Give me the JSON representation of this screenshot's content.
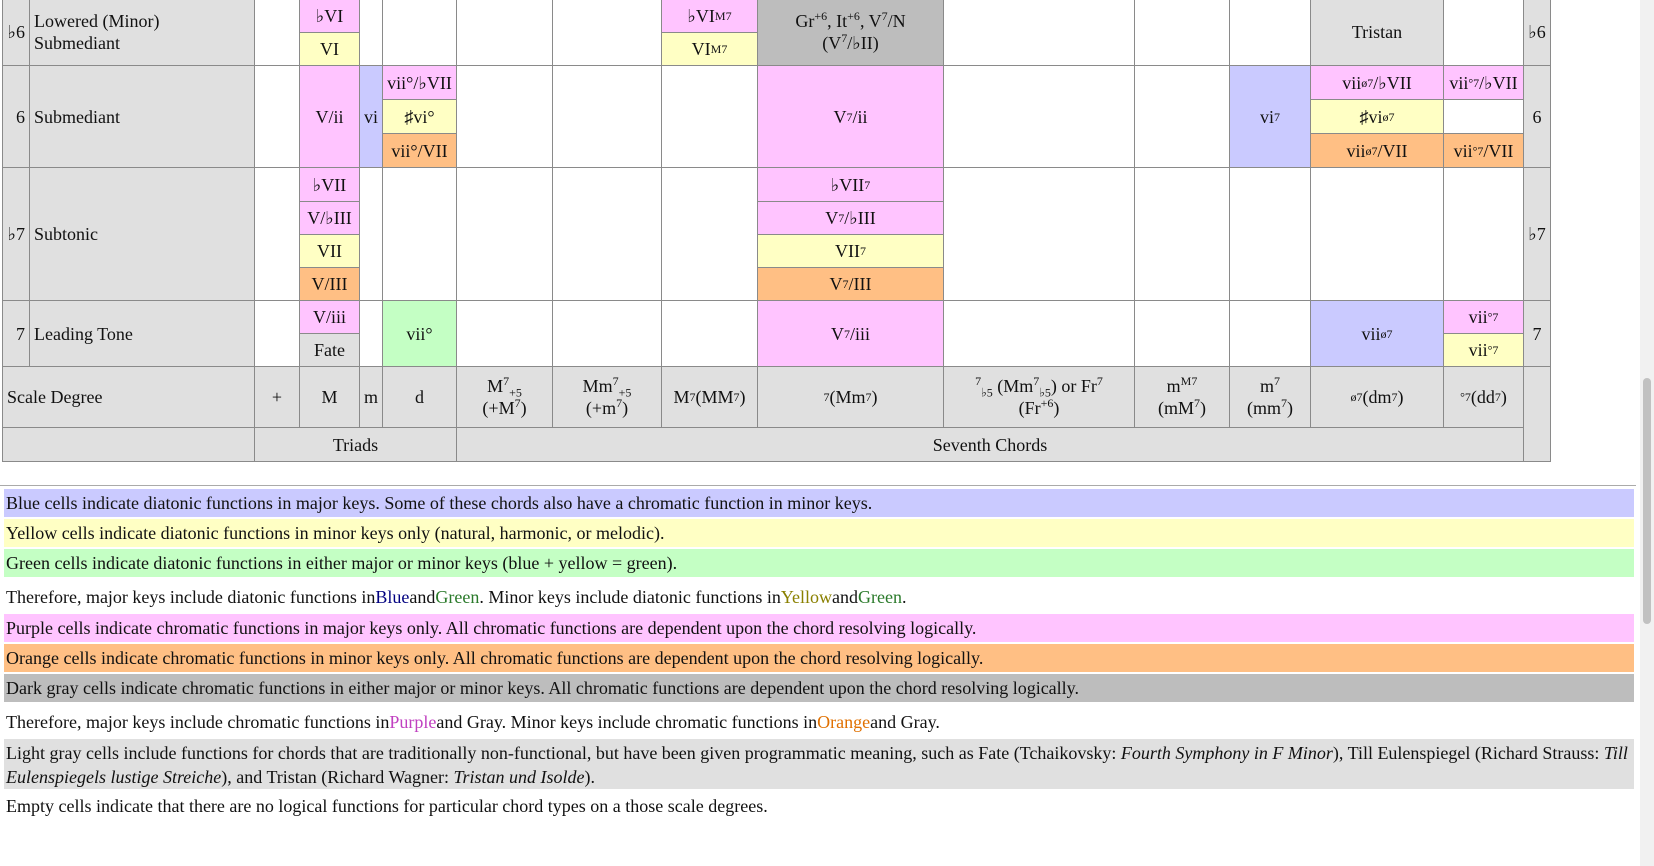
{
  "rows": {
    "r6b": {
      "deg": "♭6",
      "name_l1": "Lowered (Minor)",
      "name_l2": "Submediant",
      "right": "♭6"
    },
    "r6": {
      "deg": "6",
      "name": "Submediant",
      "right": "6"
    },
    "r7b": {
      "deg": "♭7",
      "name": "Subtonic",
      "right": "♭7"
    },
    "r7": {
      "deg": "7",
      "name": "Leading Tone",
      "right": "7"
    }
  },
  "cells": {
    "bVI": "♭VI",
    "VI": "VI",
    "bVIM7": "♭VI",
    "bVIM7_sup": "M7",
    "VIM7": "VI",
    "VIM7_sup": "M7",
    "gr_line1": "Gr",
    "gr_plus6": "+6",
    ", It": ", It",
    "it_plus6": "+6",
    "v7n": ", V",
    "v7n_sup": "7",
    "v7n_end": "/N",
    "gr_line2": "(V",
    "gr_line2_sup": "7",
    "gr_line2_end": "/♭II)",
    "tristan": "Tristan",
    "Vii": "V/ii",
    "vi": "vi",
    "viio_bVII": "vii°/♭VII",
    "sharp_vio": "♯vi°",
    "viio_VII": "vii°/VII",
    "V7ii": "V",
    "V7ii_sup": "7",
    "V7ii_end": "/ii",
    "vi7": "vi",
    "vi7_sup": "7",
    "vii07_bVII": "vii",
    "vii07_bVII_sup": "ø7",
    "vii07_bVII_end": "/♭VII",
    "viio7_bVII": "vii",
    "viio7_bVII_sup": "°7",
    "viio7_bVII_end": "/♭VII",
    "sharp_vi07": "♯vi",
    "sharp_vi07_sup": "ø7",
    "vii07_VII": "vii",
    "vii07_VII_sup": "ø7",
    "vii07_VII_end": "/VII",
    "viio7_VII": "vii",
    "viio7_VII_sup": "°7",
    "viio7_VII_end": "/VII",
    "bVII": "♭VII",
    "VbIII": "V/♭III",
    "VII": "VII",
    "VIII": "V/III",
    "bVII7": "♭VII",
    "bVII7_sup": "7",
    "V7bIII": "V",
    "V7bIII_sup": "7",
    "V7bIII_end": "/♭III",
    "VII7": "VII",
    "VII7_sup": "7",
    "V7III": "V",
    "V7III_sup": "7",
    "V7III_end": "/III",
    "Viii": "V/iii",
    "fate": "Fate",
    "viio": "vii°",
    "V7iii": "V",
    "V7iii_sup": "7",
    "V7iii_end": "/iii",
    "vii07": "vii",
    "vii07_sup": "ø7",
    "viio7": "vii",
    "viio7_sup": "°7"
  },
  "header": {
    "scale_degree": "Scale Degree",
    "plus": "+",
    "M": "M",
    "m": "m",
    "d": "d",
    "M7p5_a": "M",
    "M7p5_sup": "7",
    "M7p5_sub": "+5",
    "M7p5_b": "(+M",
    "M7p5_b_sup": "7",
    "M7p5_b_end": ")",
    "Mm7p5_a": "Mm",
    "Mm7p5_sup": "7",
    "Mm7p5_sub": "+5",
    "Mm7p5_b": "(+m",
    "Mm7p5_b_sup": "7",
    "Mm7p5_b_end": ")",
    "M7": "M",
    "M7_sup": "7",
    "MM7": " (MM",
    "MM7_sup": "7",
    "MM7_end": ")",
    "dom7_sup": "7",
    "dom7": " (Mm",
    "dom7_sup2": "7",
    "dom7_end": ")",
    "fr_sup": "7",
    "fr_sub": "♭5",
    "fr_a": " (Mm",
    "fr_sup2": "7",
    "fr_sub2": "♭5",
    "fr_b": ") or Fr",
    "fr_sup3": "7",
    "fr_line2": "(Fr",
    "fr_line2_sup": "+6",
    "fr_line2_end": ")",
    "mM7": "m",
    "mM7_sup": "M7",
    "mM7_b": "(mM",
    "mM7_b_sup": "7",
    "mM7_b_end": ")",
    "m7": "m",
    "m7_sup": "7",
    "m7_b": "(mm",
    "m7_b_sup": "7",
    "m7_b_end": ")",
    "hd7_sup": "ø7",
    "hd7": " (dm",
    "hd7_sup2": "7",
    "hd7_end": ")",
    "fd7_sup": "°7",
    "fd7": " (dd",
    "fd7_sup2": "7",
    "fd7_end": ")",
    "triads": "Triads",
    "sevenths": "Seventh Chords"
  },
  "legend": {
    "blue": "Blue cells indicate diatonic functions in major keys. Some of these chords also have a chromatic function in minor keys.",
    "yellow": "Yellow cells indicate diatonic functions in minor keys only (natural, harmonic, or melodic).",
    "green": "Green cells indicate diatonic functions in either major or minor keys (blue + yellow = green).",
    "t1_a": "Therefore, major keys include diatonic functions in ",
    "t1_blue": "Blue",
    "t1_and1": " and ",
    "t1_green": "Green",
    "t1_b": ". Minor keys include diatonic functions in ",
    "t1_yellow": "Yellow",
    "t1_and2": " and ",
    "t1_green2": "Green",
    "t1_end": ".",
    "purple": "Purple cells indicate chromatic functions in major keys only. All chromatic functions are dependent upon the chord resolving logically.",
    "orange": "Orange cells indicate chromatic functions in minor keys only. All chromatic functions are dependent upon the chord resolving logically.",
    "darkgray": "Dark gray cells indicate chromatic functions in either major or minor keys. All chromatic functions are dependent upon the chord resolving logically.",
    "t2_a": "Therefore, major keys include chromatic functions in ",
    "t2_purple": "Purple",
    "t2_and1": " and Gray. Minor keys include chromatic functions in ",
    "t2_orange": "Orange",
    "t2_end": " and Gray.",
    "lg_a": "Light gray cells include functions for chords that are traditionally non-functional, but have been given programmatic meaning, such as Fate (Tchaikovsky: ",
    "lg_i1": "Fourth Symphony in F Minor",
    "lg_b": "), Till Eulenspiegel (Richard Strauss: ",
    "lg_i2": "Till Eulenspiegels lustige Streiche",
    "lg_c": "), and Tristan (Richard Wagner: ",
    "lg_i3": "Tristan und Isolde",
    "lg_d": ").",
    "empty": "Empty cells indicate that there are no logical functions for particular chord types on a those scale degrees."
  },
  "colors": {
    "blue": "#cacaff",
    "yellow": "#ffffc4",
    "green": "#c4ffc4",
    "purple": "#ffc4ff",
    "orange": "#ffbf84",
    "darkgray": "#bdbdbd",
    "lightgray": "#e0e0e0"
  }
}
